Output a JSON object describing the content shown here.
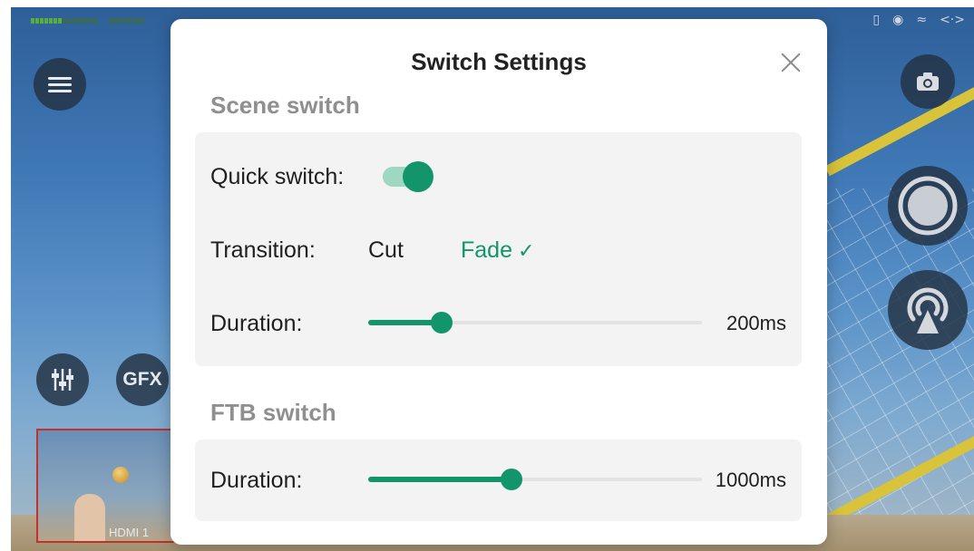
{
  "dialog": {
    "title": "Switch Settings",
    "close_icon": "close-icon"
  },
  "scene_switch": {
    "title": "Scene switch",
    "quick_switch_label": "Quick switch:",
    "quick_switch_on": true,
    "transition_label": "Transition:",
    "transition_options": [
      "Cut",
      "Fade"
    ],
    "transition_selected": "Fade",
    "duration_label": "Duration:",
    "duration_value": "200ms",
    "duration_fraction": 0.22
  },
  "ftb_switch": {
    "title": "FTB switch",
    "duration_label": "Duration:",
    "duration_value": "1000ms",
    "duration_fraction": 0.43
  },
  "background": {
    "menu_icon": "hamburger-menu-icon",
    "camera_icon": "camera-icon",
    "record_icon": "record-icon",
    "live_icon": "live-broadcast-icon",
    "mixer_icon": "audio-mixer-icon",
    "gfx_label": "GFX",
    "source_label": "HDMI 1"
  },
  "colors": {
    "accent": "#13956b",
    "accent_light": "#9ed8c3",
    "panel_bg": "#f3f3f3",
    "section_title": "#8f8f8f"
  }
}
